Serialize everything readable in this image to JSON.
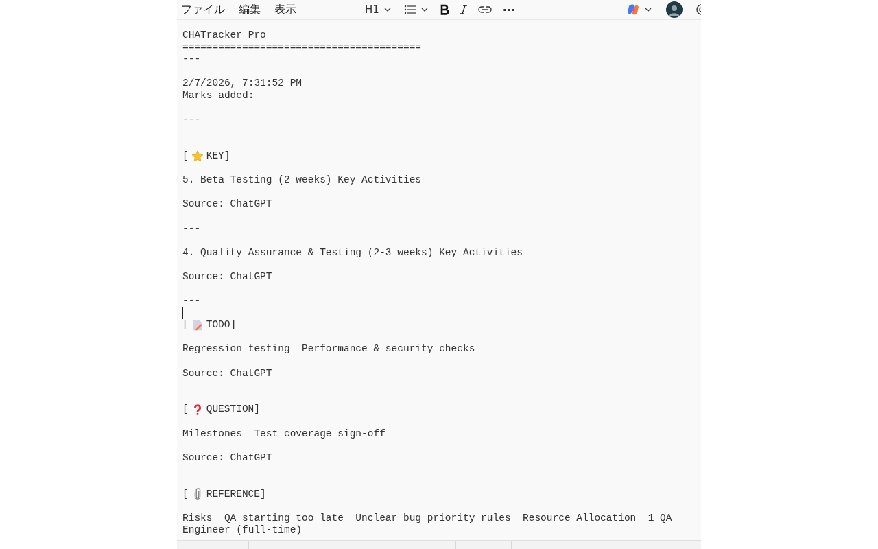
{
  "menu": [
    {
      "label": "ファイル"
    },
    {
      "label": "編集"
    },
    {
      "label": "表示"
    }
  ],
  "toolbar": {
    "heading": "H1",
    "more": "···"
  },
  "lines": [
    {
      "kind": "text",
      "text": "CHATracker Pro"
    },
    {
      "kind": "text",
      "text": "========================================"
    },
    {
      "kind": "text",
      "text": "---"
    },
    {
      "kind": "blank"
    },
    {
      "kind": "text",
      "text": "2/7/2026, 7:31:52 PM"
    },
    {
      "kind": "text",
      "text": "Marks added:"
    },
    {
      "kind": "blank"
    },
    {
      "kind": "text",
      "text": "---"
    },
    {
      "kind": "blank"
    },
    {
      "kind": "blank"
    },
    {
      "kind": "star",
      "open": "[",
      "text": "KEY]"
    },
    {
      "kind": "blank"
    },
    {
      "kind": "text",
      "text": "5. Beta Testing (2 weeks) Key Activities"
    },
    {
      "kind": "blank"
    },
    {
      "kind": "text",
      "text": "Source: ChatGPT"
    },
    {
      "kind": "blank"
    },
    {
      "kind": "text",
      "text": "---"
    },
    {
      "kind": "blank"
    },
    {
      "kind": "text",
      "text": "4. Quality Assurance & Testing (2-3 weeks) Key Activities"
    },
    {
      "kind": "blank"
    },
    {
      "kind": "text",
      "text": "Source: ChatGPT"
    },
    {
      "kind": "blank"
    },
    {
      "kind": "text",
      "text": "---"
    },
    {
      "kind": "cursor"
    },
    {
      "kind": "memo",
      "open": "[",
      "text": "TODO]"
    },
    {
      "kind": "blank"
    },
    {
      "kind": "text",
      "text": "Regression testing  Performance & security checks"
    },
    {
      "kind": "blank"
    },
    {
      "kind": "text",
      "text": "Source: ChatGPT"
    },
    {
      "kind": "blank"
    },
    {
      "kind": "blank"
    },
    {
      "kind": "question",
      "open": "[",
      "text": "QUESTION]"
    },
    {
      "kind": "blank"
    },
    {
      "kind": "text",
      "text": "Milestones  Test coverage sign-off"
    },
    {
      "kind": "blank"
    },
    {
      "kind": "text",
      "text": "Source: ChatGPT"
    },
    {
      "kind": "blank"
    },
    {
      "kind": "blank"
    },
    {
      "kind": "paperclip",
      "open": "[",
      "text": "REFERENCE]"
    },
    {
      "kind": "blank"
    },
    {
      "kind": "text",
      "text": "Risks  QA starting too late  Unclear bug priority rules  Resource Allocation  1 QA"
    },
    {
      "kind": "text",
      "text": "Engineer (full-time)"
    }
  ]
}
